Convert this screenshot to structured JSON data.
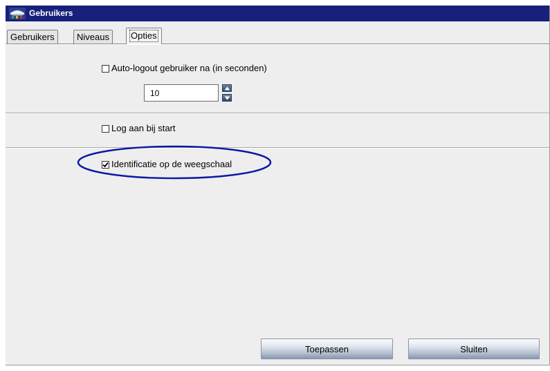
{
  "window": {
    "title": "Gebruikers",
    "title_bar_color": "#17207a",
    "app_icon": "scale-app-icon"
  },
  "tabs": [
    {
      "label": "Gebruikers",
      "active": false
    },
    {
      "label": "Niveaus",
      "active": false
    },
    {
      "label": "Opties",
      "active": true
    }
  ],
  "options": {
    "auto_logout": {
      "label": "Auto-logout gebruiker na (in seconden)",
      "checked": false,
      "value": "10",
      "spin_up_icon": "arrow-up-icon",
      "spin_down_icon": "arrow-down-icon"
    },
    "log_at_start": {
      "label": "Log aan bij start",
      "checked": false
    },
    "identification": {
      "label": "Identificatie op de weegschaal",
      "checked": true,
      "highlight_color": "#0a1aa6"
    }
  },
  "buttons": {
    "apply": "Toepassen",
    "close": "Sluiten"
  }
}
